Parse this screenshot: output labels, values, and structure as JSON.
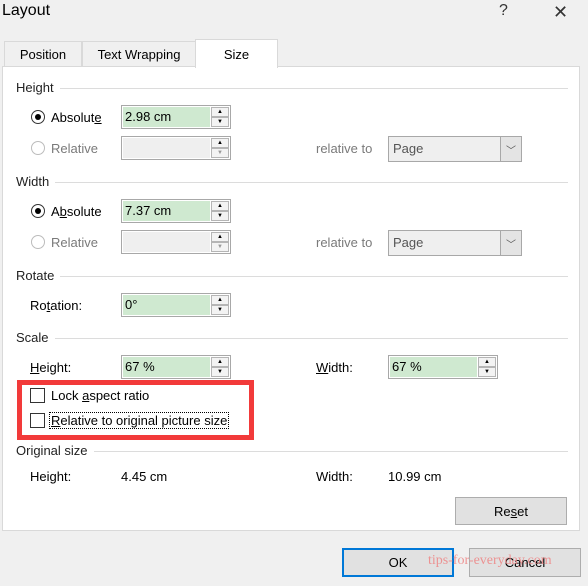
{
  "window": {
    "title": "Layout",
    "help_label": "?",
    "close_label": "✕"
  },
  "tabs": [
    {
      "label": "Position",
      "active": false
    },
    {
      "label": "Text Wrapping",
      "active": false
    },
    {
      "label": "Size",
      "active": true
    }
  ],
  "height": {
    "section": "Height",
    "absolute_label_pre": "Absolut",
    "absolute_label_key": "e",
    "absolute_value": "2.98 cm",
    "relative_label": "Relative",
    "relative_value": "",
    "relative_to_label": "relative to",
    "relative_to_value": "Page"
  },
  "width": {
    "section": "Width",
    "absolute_label_pre": "A",
    "absolute_label_key": "b",
    "absolute_label_post": "solute",
    "absolute_value": "7.37 cm",
    "relative_label": "Relative",
    "relative_value": "",
    "relative_to_label": "relative to",
    "relative_to_value": "Page"
  },
  "rotate": {
    "section": "Rotate",
    "rotation_label_pre": "Ro",
    "rotation_label_key": "t",
    "rotation_label_post": "ation:",
    "rotation_value": "0°"
  },
  "scale": {
    "section": "Scale",
    "height_label_key": "H",
    "height_label_post": "eight:",
    "height_value": "67 %",
    "width_label_key": "W",
    "width_label_post": "idth:",
    "width_value": "67 %",
    "lock_aspect_pre": "Lock ",
    "lock_aspect_key": "a",
    "lock_aspect_post": "spect ratio",
    "lock_aspect_checked": false,
    "relative_original_key": "R",
    "relative_original_post": "elative to original picture size",
    "relative_original_checked": false
  },
  "original_size": {
    "section": "Original size",
    "height_label": "Height:",
    "height_value": "4.45 cm",
    "width_label": "Width:",
    "width_value": "10.99 cm"
  },
  "buttons": {
    "reset_pre": "Re",
    "reset_key": "s",
    "reset_post": "et",
    "ok": "OK",
    "cancel": "Cancel"
  },
  "watermark": "tips-for-everyday.com",
  "colors": {
    "highlight_box": "#f23a3a",
    "active_field": "#cfe9d0",
    "default_button_border": "#0078d7"
  },
  "icons": {
    "up": "▲",
    "down": "▼",
    "dropdown": "﹀"
  }
}
